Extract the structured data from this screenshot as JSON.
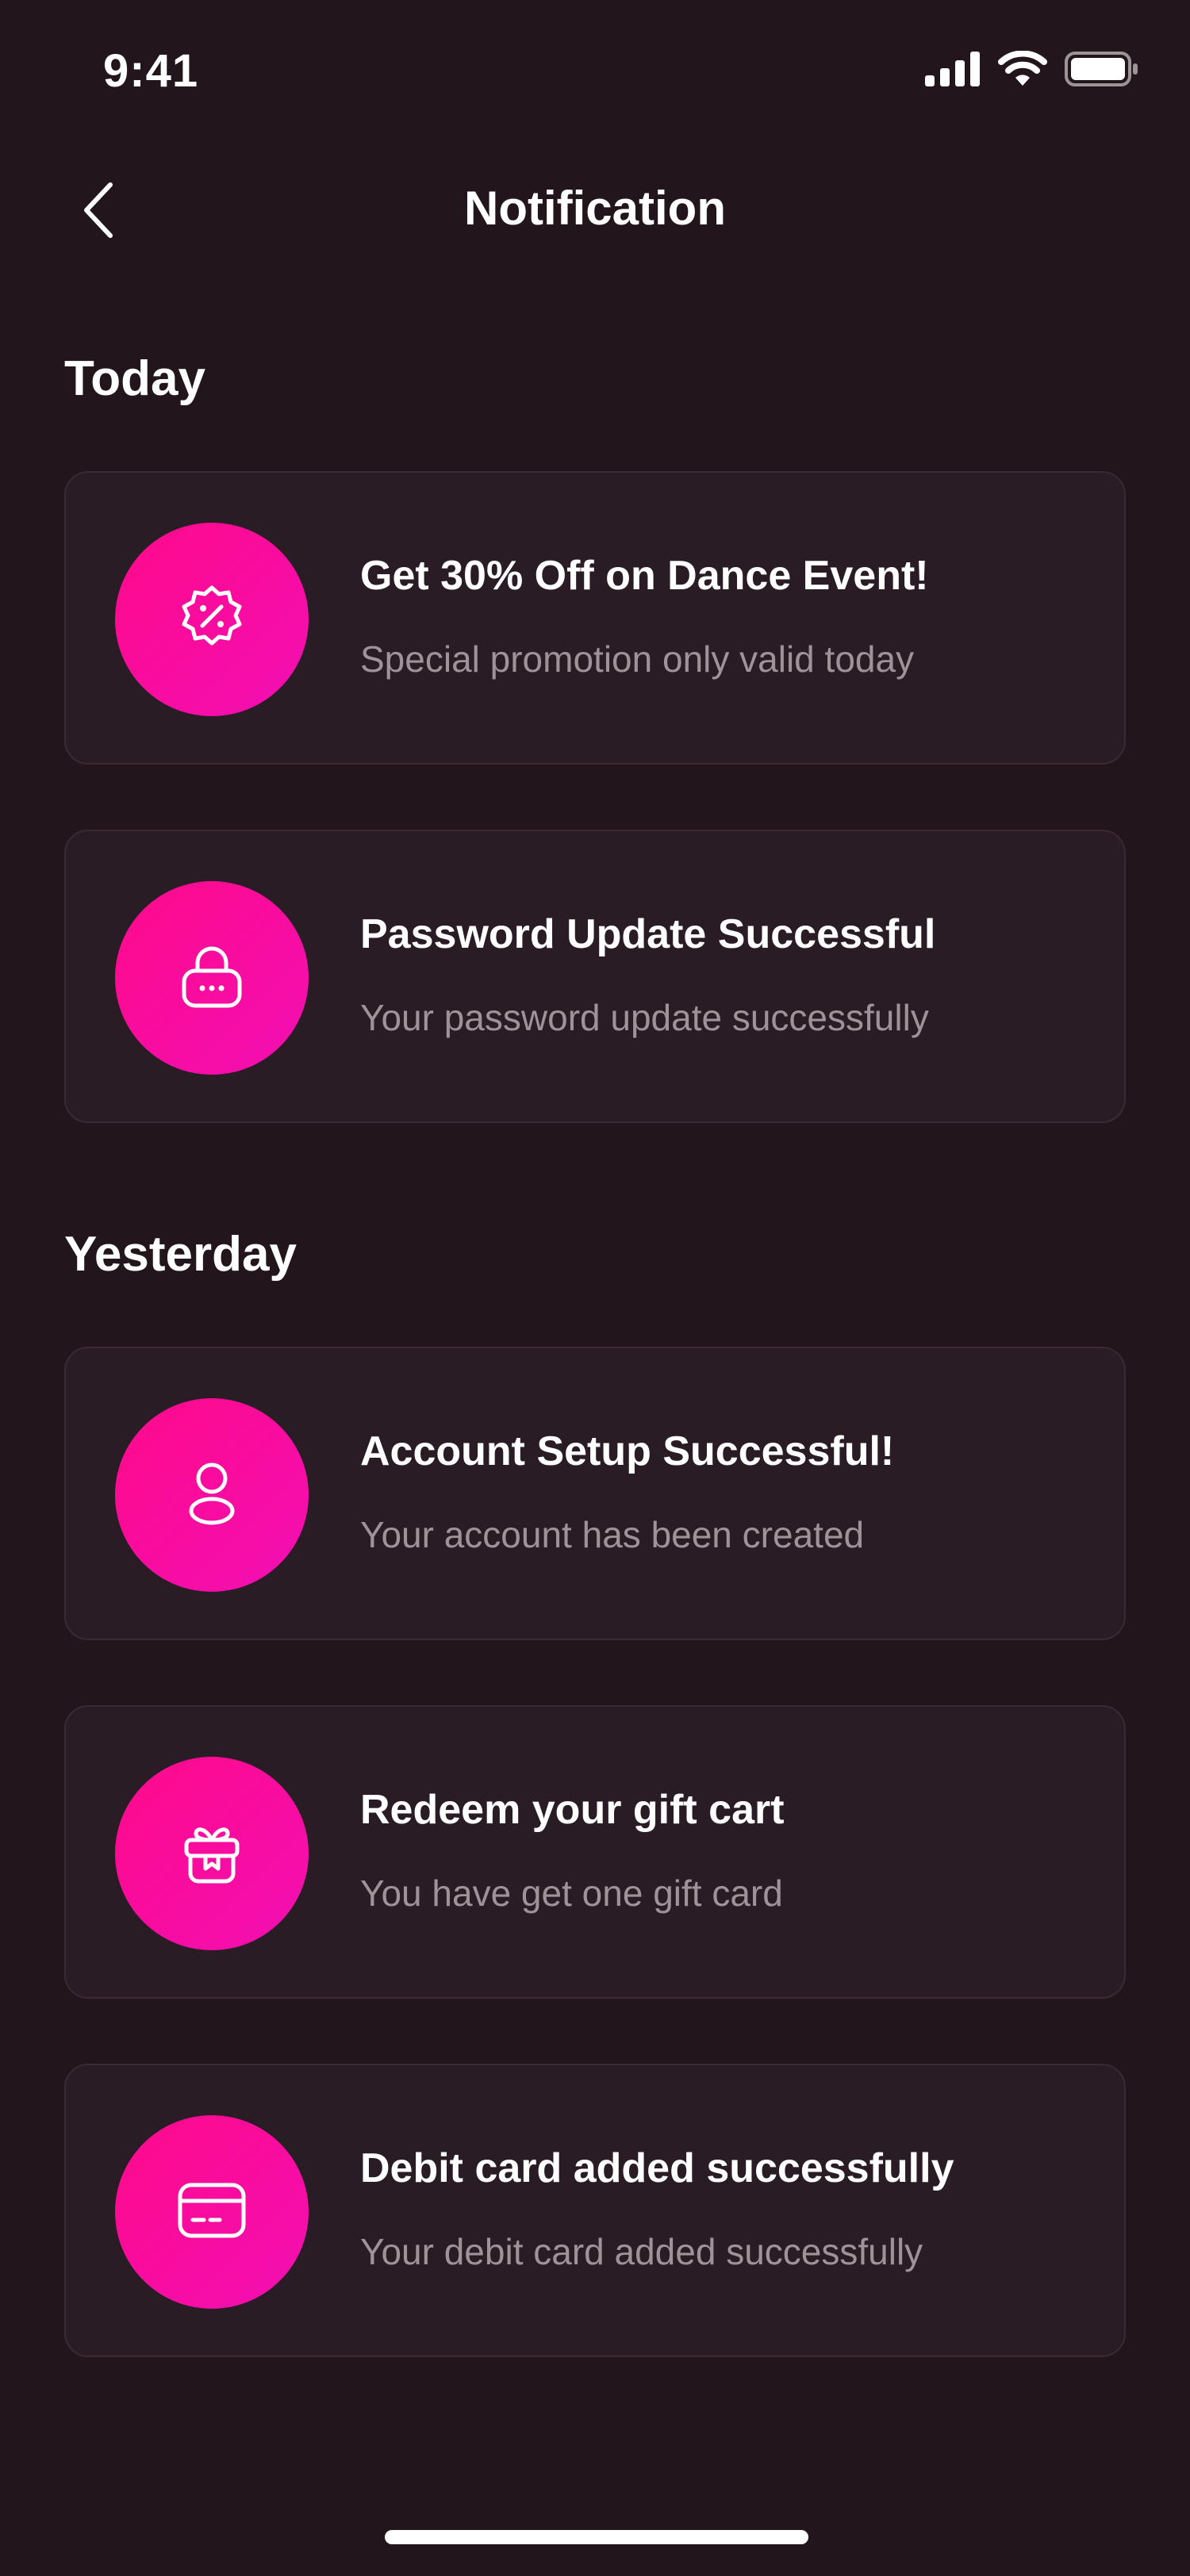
{
  "status_bar": {
    "time": "9:41",
    "icons": [
      "cellular-signal-icon",
      "wifi-icon",
      "battery-icon"
    ]
  },
  "header": {
    "title": "Notification",
    "back_icon": "chevron-left-icon"
  },
  "sections": [
    {
      "heading": "Today",
      "items": [
        {
          "icon": "discount-badge-icon",
          "title": "Get 30% Off on Dance Event!",
          "subtitle": "Special promotion only valid today"
        },
        {
          "icon": "lock-icon",
          "title": "Password Update Successful",
          "subtitle": "Your password update successfully"
        }
      ]
    },
    {
      "heading": "Yesterday",
      "items": [
        {
          "icon": "user-icon",
          "title": "Account Setup Successful!",
          "subtitle": "Your account has been created"
        },
        {
          "icon": "gift-icon",
          "title": "Redeem your gift cart",
          "subtitle": "You have get one gift card"
        },
        {
          "icon": "credit-card-icon",
          "title": "Debit card added successfully",
          "subtitle": "Your debit card added successfully"
        }
      ]
    }
  ],
  "colors": {
    "background": "#22151b",
    "card_background": "#2a1c24",
    "card_border": "#3a2a33",
    "accent_gradient_start": "#ff0a8a",
    "accent_gradient_end": "#f20fb4",
    "subtitle_text": "#9d9398"
  }
}
